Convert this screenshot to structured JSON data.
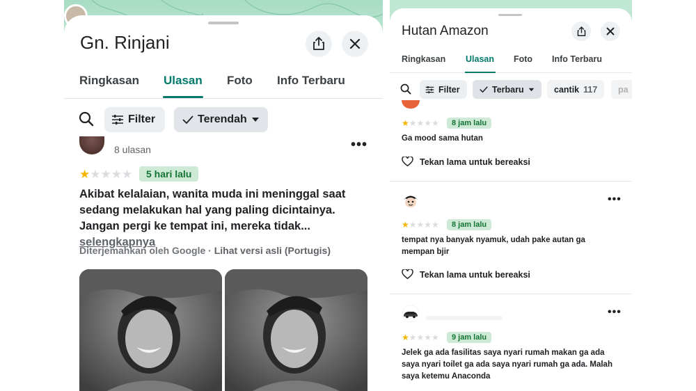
{
  "left": {
    "title": "Gn. Rinjani",
    "tabs": [
      {
        "label": "Ringkasan"
      },
      {
        "label": "Ulasan"
      },
      {
        "label": "Foto"
      },
      {
        "label": "Info Terbaru"
      }
    ],
    "filter_label": "Filter",
    "sort_label": "Terendah",
    "review": {
      "review_count": "8 ulasan",
      "rating": 1,
      "time": "5 hari lalu",
      "text": "Akibat kelalaian, wanita muda ini meninggal saat sedang melakukan hal yang paling dicintainya. Jangan pergi ke tempat ini, mereka tidak...",
      "more_link": "selengkapnya",
      "translated_by": "Diterjemahkan oleh Google",
      "separator": " · ",
      "original_link": "Lihat versi asli (Portugis)"
    }
  },
  "right": {
    "title": "Hutan Amazon",
    "tabs": [
      {
        "label": "Ringkasan"
      },
      {
        "label": "Ulasan"
      },
      {
        "label": "Foto"
      },
      {
        "label": "Info Terbaru"
      }
    ],
    "filter_label": "Filter",
    "sort_label": "Terbaru",
    "topic_label": "cantik",
    "topic_count": "117",
    "topic2_label": "pa",
    "react_label": "Tekan lama untuk bereaksi",
    "reviews": [
      {
        "rating": 1,
        "time": "8 jam lalu",
        "text": "Ga mood sama hutan"
      },
      {
        "rating": 1,
        "time": "8 jam lalu",
        "text": "tempat nya banyak nyamuk, udah pake autan ga mempan bjir"
      },
      {
        "rating": 1,
        "time": "9 jam lalu",
        "text": "Jelek ga ada fasilitas saya nyari rumah makan ga ada saya nyari toilet ga ada saya nyari rumah ga ada. Malah saya ketemu Anaconda"
      }
    ]
  },
  "colors": {
    "accent": "#00796b",
    "star": "#f4b400",
    "badge_bg": "#ceead6",
    "badge_text": "#137333"
  },
  "icons": [
    "share-icon",
    "close-icon",
    "search-icon",
    "filter-icon",
    "check-icon",
    "caret-down-icon",
    "heart-icon",
    "more-icon"
  ]
}
